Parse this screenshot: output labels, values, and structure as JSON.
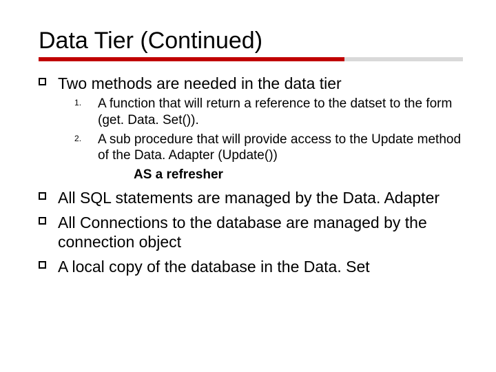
{
  "title": "Data Tier (Continued)",
  "bullets": {
    "b1": "Two methods are needed in the data tier",
    "n1": "A function that will return a reference to the datset to the form (get. Data. Set()).",
    "n2": "A sub procedure that will provide access to the Update method of the Data. Adapter (Update())",
    "refresher": "AS a refresher",
    "b2": "All SQL statements are managed by the Data. Adapter",
    "b3": "All Connections to the database are managed by the connection object",
    "b4": "A local copy of the database in the Data. Set"
  }
}
